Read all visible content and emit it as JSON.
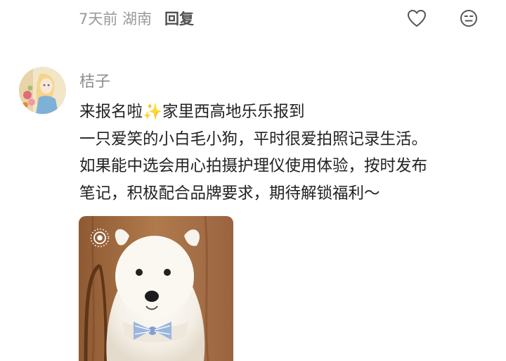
{
  "post_meta": {
    "time_location": "7天前 湖南",
    "reply_label": "回复"
  },
  "comment": {
    "username": "桔子",
    "lines": [
      "来报名啦✨家里西高地乐乐报到",
      "一只爱笑的小白毛小狗，平时很爱拍照记录生活。",
      "如果能中选会用心拍摄护理仪使用体验，按时发布",
      "笔记，积极配合品牌要求，期待解锁福利～"
    ]
  },
  "icons": {
    "like": "heart-icon",
    "react": "emoji-face-icon",
    "live_photo": "live-photo-icon"
  },
  "colors": {
    "text_primary": "#222222",
    "text_secondary": "#9a9a9a",
    "background": "#ffffff"
  }
}
